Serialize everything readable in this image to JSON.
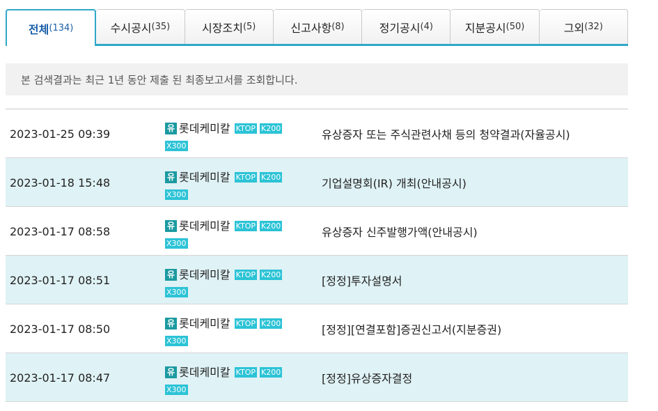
{
  "tabs": [
    {
      "label": "전체",
      "count": "(134)"
    },
    {
      "label": "수시공시",
      "count": "(35)"
    },
    {
      "label": "시장조치",
      "count": "(5)"
    },
    {
      "label": "신고사항",
      "count": "(8)"
    },
    {
      "label": "정기공시",
      "count": "(4)"
    },
    {
      "label": "지분공시",
      "count": "(50)"
    },
    {
      "label": "그외",
      "count": "(32)"
    }
  ],
  "notice": "본 검색결과는 최근 1년 동안 제출 된 최종보고서를 조회합니다.",
  "rows": [
    {
      "time": "2023-01-25 09:39",
      "market": "유",
      "company": "롯데케미칼",
      "badges": [
        "KTOP",
        "K200",
        "X300"
      ],
      "title": "유상증자 또는 주식관련사채 등의 청약결과(자율공시)"
    },
    {
      "time": "2023-01-18 15:48",
      "market": "유",
      "company": "롯데케미칼",
      "badges": [
        "KTOP",
        "K200",
        "X300"
      ],
      "title": "기업설명회(IR) 개최(안내공시)"
    },
    {
      "time": "2023-01-17 08:58",
      "market": "유",
      "company": "롯데케미칼",
      "badges": [
        "KTOP",
        "K200",
        "X300"
      ],
      "title": "유상증자 신주발행가액(안내공시)"
    },
    {
      "time": "2023-01-17 08:51",
      "market": "유",
      "company": "롯데케미칼",
      "badges": [
        "KTOP",
        "K200",
        "X300"
      ],
      "title": "[정정]투자설명서"
    },
    {
      "time": "2023-01-17 08:50",
      "market": "유",
      "company": "롯데케미칼",
      "badges": [
        "KTOP",
        "K200",
        "X300"
      ],
      "title": "[정정][연결포함]증권신고서(지분증권)"
    },
    {
      "time": "2023-01-17 08:47",
      "market": "유",
      "company": "롯데케미칼",
      "badges": [
        "KTOP",
        "K200",
        "X300"
      ],
      "title": "[정정]유상증자결정"
    }
  ],
  "colors": {
    "accent": "#2ea8c8",
    "active_tab_text": "#1a5fa8",
    "row_alt": "#dff2f5",
    "market_badge": "#1a9aa0",
    "index_badge": "#2cc3d6"
  }
}
